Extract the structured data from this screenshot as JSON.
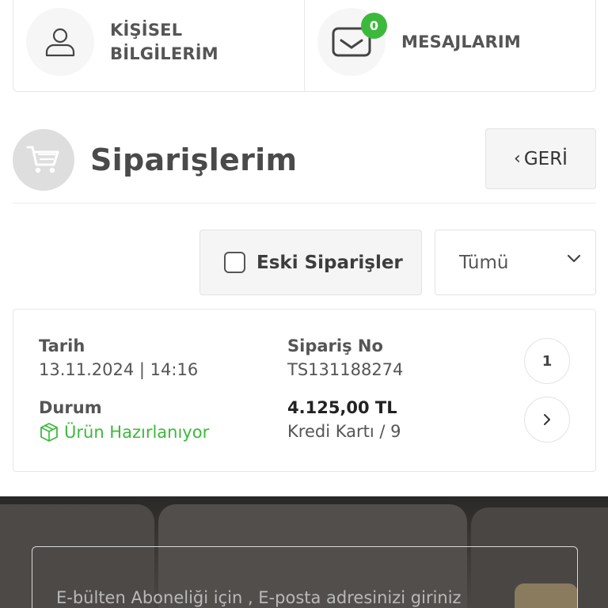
{
  "account_nav": {
    "personal_info": {
      "label_line1": "KİŞİSEL",
      "label_line2": "BİLGİLERİM",
      "icon": "user-icon"
    },
    "messages": {
      "label": "MESAJLARIM",
      "badge_count": "0",
      "icon": "envelope-icon"
    }
  },
  "orders_header": {
    "title": "Siparişlerim",
    "back_label": "GERİ",
    "icon": "cart-icon"
  },
  "filters": {
    "old_orders_label": "Eski Siparişler",
    "old_orders_checked": false,
    "status_select_value": "Tümü"
  },
  "orders": [
    {
      "date_label": "Tarih",
      "date_value": "13.11.2024 | 14:16",
      "order_no_label": "Sipariş No",
      "order_no_value": "TS131188274",
      "status_label": "Durum",
      "status_value": "Ürün Hazırlanıyor",
      "amount": "4.125,00 TL",
      "payment": "Kredi Kartı / 9",
      "item_count": "1"
    }
  ],
  "newsletter": {
    "placeholder": "E-bülten Aboneliği için , E-posta adresinizi giriniz"
  },
  "colors": {
    "accent_green": "#3cb93c",
    "text_dark": "#4a4a4a",
    "border": "#e6e6e6"
  }
}
